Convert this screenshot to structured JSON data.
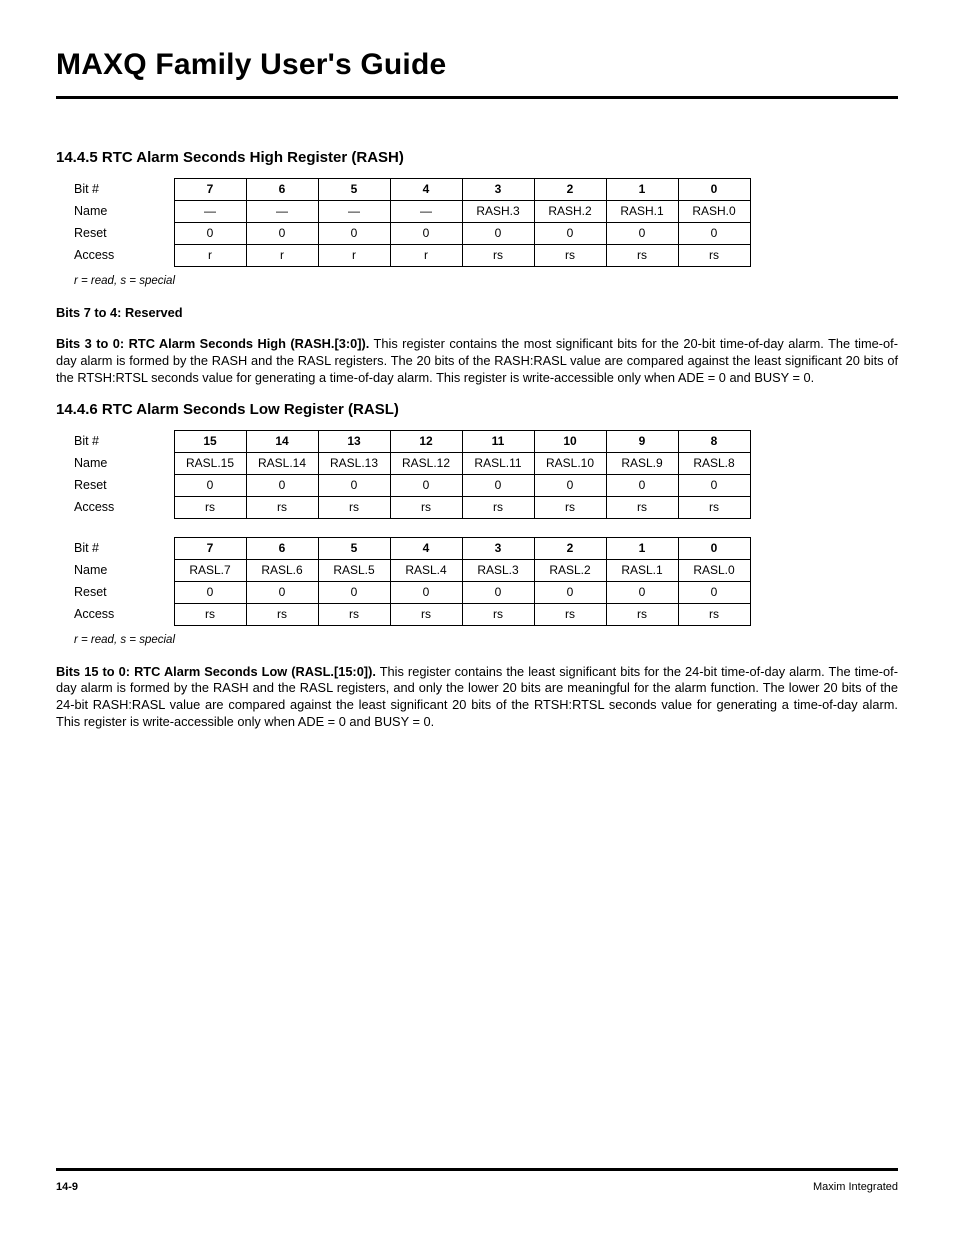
{
  "doc_title": "MAXQ Family User's Guide",
  "section1": {
    "heading": "14.4.5 RTC Alarm Seconds High Register (RASH)",
    "row_labels": {
      "bit": "Bit #",
      "name": "Name",
      "reset": "Reset",
      "access": "Access"
    },
    "bits": [
      "7",
      "6",
      "5",
      "4",
      "3",
      "2",
      "1",
      "0"
    ],
    "names": [
      "—",
      "—",
      "—",
      "—",
      "RASH.3",
      "RASH.2",
      "RASH.1",
      "RASH.0"
    ],
    "resets": [
      "0",
      "0",
      "0",
      "0",
      "0",
      "0",
      "0",
      "0"
    ],
    "access": [
      "r",
      "r",
      "r",
      "r",
      "rs",
      "rs",
      "rs",
      "rs"
    ],
    "note": "r = read, s = special",
    "para1_bold": "Bits 7 to 4: Reserved",
    "para2_bold": "Bits 3 to 0: RTC Alarm Seconds High (RASH.[3:0]).",
    "para2_rest": " This register contains the most significant bits for the 20-bit time-of-day alarm. The time-of-day alarm is formed by the RASH and the RASL registers. The 20 bits of the RASH:RASL value are compared against the least significant 20 bits of the RTSH:RTSL seconds value for generating a time-of-day alarm. This register is write-accessible only when ADE = 0 and BUSY = 0."
  },
  "section2": {
    "heading": "14.4.6 RTC Alarm Seconds Low Register (RASL)",
    "row_labels": {
      "bit": "Bit #",
      "name": "Name",
      "reset": "Reset",
      "access": "Access"
    },
    "hi": {
      "bits": [
        "15",
        "14",
        "13",
        "12",
        "11",
        "10",
        "9",
        "8"
      ],
      "names": [
        "RASL.15",
        "RASL.14",
        "RASL.13",
        "RASL.12",
        "RASL.11",
        "RASL.10",
        "RASL.9",
        "RASL.8"
      ],
      "resets": [
        "0",
        "0",
        "0",
        "0",
        "0",
        "0",
        "0",
        "0"
      ],
      "access": [
        "rs",
        "rs",
        "rs",
        "rs",
        "rs",
        "rs",
        "rs",
        "rs"
      ]
    },
    "lo": {
      "bits": [
        "7",
        "6",
        "5",
        "4",
        "3",
        "2",
        "1",
        "0"
      ],
      "names": [
        "RASL.7",
        "RASL.6",
        "RASL.5",
        "RASL.4",
        "RASL.3",
        "RASL.2",
        "RASL.1",
        "RASL.0"
      ],
      "resets": [
        "0",
        "0",
        "0",
        "0",
        "0",
        "0",
        "0",
        "0"
      ],
      "access": [
        "rs",
        "rs",
        "rs",
        "rs",
        "rs",
        "rs",
        "rs",
        "rs"
      ]
    },
    "note": "r = read, s = special",
    "para_bold": "Bits 15 to 0: RTC Alarm Seconds Low (RASL.[15:0]).",
    "para_rest": " This register contains the least significant bits for the 24-bit time-of-day alarm. The time-of-day alarm is formed by the RASH and the RASL registers, and only the lower 20 bits are meaningful for the alarm function. The lower 20 bits of the 24-bit RASH:RASL value are compared against the least significant 20 bits of the RTSH:RTSL seconds value for generating a time-of-day alarm. This register is write-accessible only when ADE = 0 and BUSY = 0."
  },
  "footer": {
    "page": "14-9",
    "brand": "Maxim Integrated"
  }
}
